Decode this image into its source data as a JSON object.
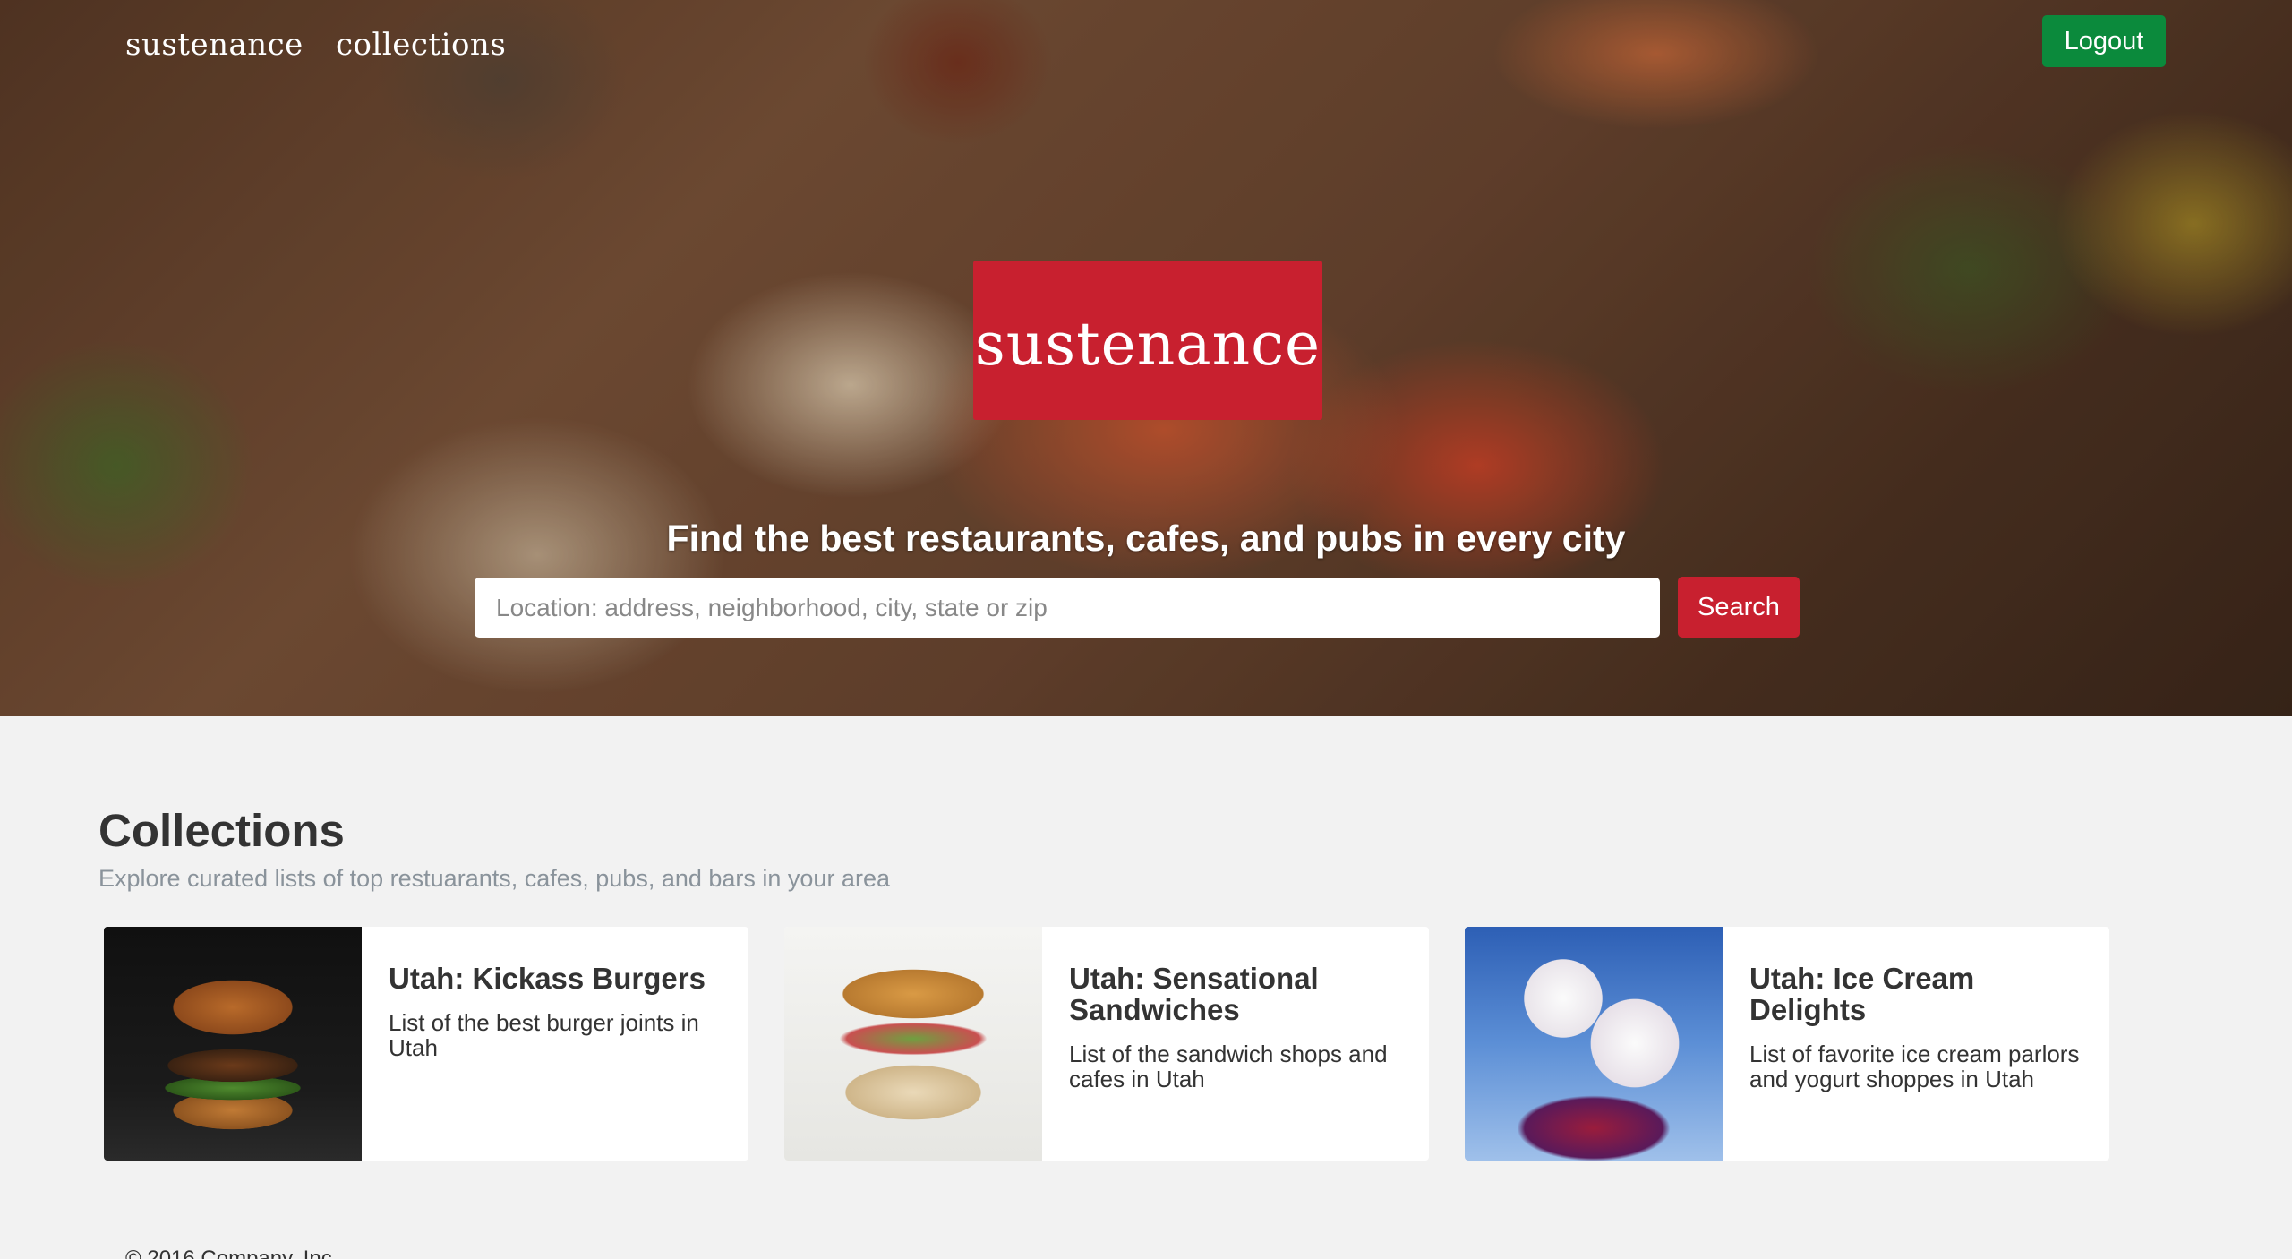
{
  "nav": {
    "home_label": "sustenance",
    "collections_label": "collections",
    "logout_label": "Logout"
  },
  "hero": {
    "logo_text": "sustenance",
    "tagline": "Find the best restaurants, cafes, and pubs in every city",
    "search_placeholder": "Location: address, neighborhood, city, state or zip",
    "search_button_label": "Search"
  },
  "collections": {
    "title": "Collections",
    "subtitle": "Explore curated lists of top restuarants, cafes, pubs, and bars in your area",
    "items": [
      {
        "title": "Utah: Kickass Burgers",
        "description": "List of the best burger joints in Utah"
      },
      {
        "title": "Utah: Sensational Sandwiches",
        "description": "List of the sandwich shops and cafes in Utah"
      },
      {
        "title": "Utah: Ice Cream Delights",
        "description": "List of favorite ice cream parlors and yogurt shoppes in Utah"
      }
    ]
  },
  "footer": {
    "text": "© 2016 Company, Inc."
  },
  "colors": {
    "brand_red": "#c8202f",
    "logout_green": "#0b8a3c",
    "page_background": "#f2f2f2"
  }
}
